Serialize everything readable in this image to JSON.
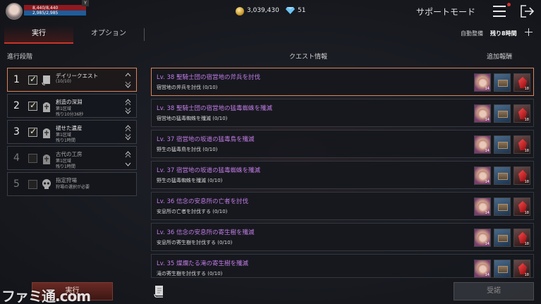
{
  "player": {
    "hp": "8,440/8,440",
    "mp": "2,985/2,985",
    "level_badge": "Y"
  },
  "currency": {
    "gold": "3,039,430",
    "gems": "51"
  },
  "header": {
    "support_mode": "サポートモード"
  },
  "tabs": [
    {
      "label": "実行"
    },
    {
      "label": "オプション"
    }
  ],
  "auto_maintenance": {
    "label": "自動整備",
    "time": "残り8時間"
  },
  "headings": {
    "progress": "進行段階",
    "quest_info": "クエスト情報",
    "extra_reward": "追加報酬"
  },
  "stages": [
    {
      "num": "1",
      "checked": true,
      "icon": "scroll-icon",
      "title": "デイリークエスト",
      "line2": "(10/10)",
      "line3": ""
    },
    {
      "num": "2",
      "checked": true,
      "icon": "tombstone-icon",
      "title": "創造の深淵",
      "line2": "第1区域",
      "line3": "残り10分36秒"
    },
    {
      "num": "3",
      "checked": true,
      "icon": "tombstone-icon",
      "title": "褪せた遺産",
      "line2": "第1区域",
      "line3": "残り1時間"
    },
    {
      "num": "4",
      "checked": false,
      "icon": "tombstone-icon",
      "title": "古代の工房",
      "line2": "第1区域",
      "line3": "残り1時間"
    },
    {
      "num": "5",
      "checked": false,
      "icon": "skull-icon",
      "title": "指定狩場",
      "line2": "狩場の選択が必要",
      "line3": ""
    }
  ],
  "quests": [
    {
      "title": "Lv. 38  聖騎士団の宿営地の斧兵を討伐",
      "sub": "宿営地の斧兵を討伐 (0/10)",
      "rewards": [
        "14",
        "",
        "18"
      ]
    },
    {
      "title": "Lv. 38  聖騎士団の宿営地の猛毒蜘蛛を殲滅",
      "sub": "宿営地の猛毒蜘蛛を殲滅 (0/10)",
      "rewards": [
        "14",
        "",
        "18"
      ]
    },
    {
      "title": "Lv. 37  宿営地の坂道の猛毒鳥を殲滅",
      "sub": "野生の猛毒鳥を討伐 (0/10)",
      "rewards": [
        "14",
        "",
        "18"
      ]
    },
    {
      "title": "Lv. 37  宿営地の坂道の猛毒蜘蛛を殲滅",
      "sub": "野生の猛毒蜘蛛を殲滅 (0/10)",
      "rewards": [
        "14",
        "",
        "18"
      ]
    },
    {
      "title": "Lv. 36  信念の安息所の亡者を討伐",
      "sub": "安息所の亡者を討伐する (0/10)",
      "rewards": [
        "14",
        "",
        "18"
      ]
    },
    {
      "title": "Lv. 36  信念の安息所の寄生樹を殲滅",
      "sub": "安息所の寄生樹を討伐する (0/10)",
      "rewards": [
        "14",
        "",
        "18"
      ]
    },
    {
      "title": "Lv. 35  燦爛たる滝の寄生樹を殲滅",
      "sub": "滝の寄生樹を討伐する (0/10)",
      "rewards": [
        "14",
        "",
        "18"
      ]
    }
  ],
  "buttons": {
    "run": "実行",
    "accept": "受諾"
  },
  "watermark": "ファミ通.com",
  "colors": {
    "accent": "#c7352a",
    "quest_title": "#c27ce6",
    "active_border": "#d7845a"
  }
}
